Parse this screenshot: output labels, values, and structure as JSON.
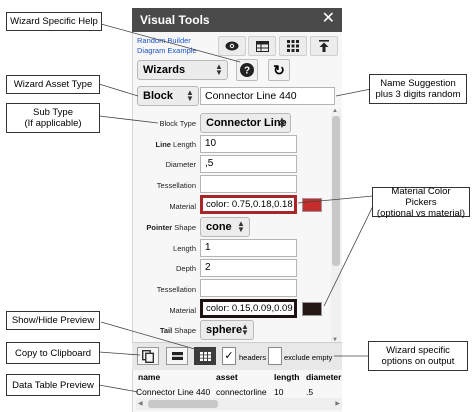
{
  "panel": {
    "title": "Visual Tools",
    "close_glyph": "✕",
    "link1": "Random Builder",
    "link2": "Diagram Example"
  },
  "toolbar": {
    "icons": [
      "eye-icon",
      "table-icon",
      "grid-icon",
      "export-icon"
    ]
  },
  "wizard_select": {
    "value": "Wizards"
  },
  "help_glyph": "?",
  "refresh_glyph": "↻",
  "asset_type": {
    "value": "Block"
  },
  "name_field": {
    "value": "Connector Line 440"
  },
  "fields": {
    "block_type": {
      "label": "Block Type",
      "value": "Connector Line"
    },
    "line_length": {
      "label_bold": "Line",
      "label_rest": " Length",
      "value": "10"
    },
    "diameter": {
      "label": "Diameter",
      "value": ",5"
    },
    "tessellation1": {
      "label": "Tessellation",
      "value": ""
    },
    "material1": {
      "label": "Material",
      "value": "color: 0.75,0.18,0.18",
      "swatch": "#c62d2d"
    },
    "pointer_shape": {
      "label_bold": "Pointer",
      "label_rest": " Shape",
      "value": "cone"
    },
    "length": {
      "label": "Length",
      "value": "1"
    },
    "depth": {
      "label": "Depth",
      "value": "2"
    },
    "tessellation2": {
      "label": "Tessellation",
      "value": ""
    },
    "material2": {
      "label": "Material",
      "value": "color: 0.15,0.09,0.09",
      "swatch": "#261717"
    },
    "tail_shape": {
      "label_bold": "Tail",
      "label_rest": " Shape",
      "value": "sphere"
    }
  },
  "options": {
    "headers_label": "headers",
    "headers_checked": "✓",
    "exclude_label": "exclude empty"
  },
  "table": {
    "columns": [
      "name",
      "asset",
      "length",
      "diameter"
    ],
    "row": [
      "Connector Line 440",
      "connectorline",
      "10",
      ".5"
    ]
  },
  "callouts": {
    "wizard_help": "Wizard Specific Help",
    "asset_type": "Wizard Asset Type",
    "sub_type": "Sub Type\n(If applicable)",
    "name_suggestion": "Name Suggestion\nplus 3 digits random",
    "material_pickers": "Material Color Pickers\n(optional vs material)",
    "show_hide": "Show/Hide Preview",
    "copy_clipboard": "Copy to Clipboard",
    "wizard_options": "Wizard specific\noptions on output",
    "table_preview": "Data Table Preview"
  }
}
